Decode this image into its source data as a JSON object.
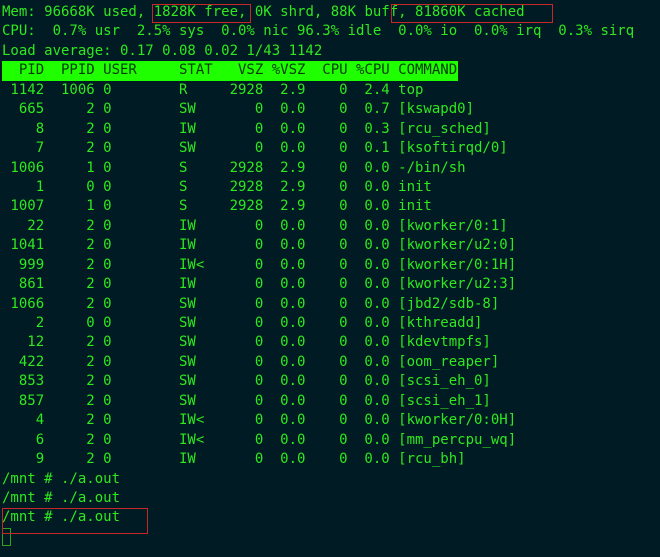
{
  "summary": {
    "mem": {
      "prefix": "Mem: 96668K used, ",
      "free": "1828K free,",
      "middle": " 0K shrd, 88K buff, ",
      "cached": "81860K cached"
    },
    "cpu": "CPU:  0.7% usr  2.5% sys  0.0% nic 96.3% idle  0.0% io  0.0% irq  0.3% sirq",
    "load": "Load average: 0.17 0.08 0.02 1/43 1142"
  },
  "table": {
    "columns": [
      "PID",
      "PPID",
      "USER",
      "STAT",
      "VSZ",
      "%VSZ",
      "CPU",
      "%CPU",
      "COMMAND"
    ],
    "rows": [
      [
        "1142",
        "1006",
        "0",
        "R",
        "2928",
        "2.9",
        "0",
        "2.4",
        "top"
      ],
      [
        "665",
        "2",
        "0",
        "SW",
        "0",
        "0.0",
        "0",
        "0.7",
        "[kswapd0]"
      ],
      [
        "8",
        "2",
        "0",
        "IW",
        "0",
        "0.0",
        "0",
        "0.3",
        "[rcu_sched]"
      ],
      [
        "7",
        "2",
        "0",
        "SW",
        "0",
        "0.0",
        "0",
        "0.1",
        "[ksoftirqd/0]"
      ],
      [
        "1006",
        "1",
        "0",
        "S",
        "2928",
        "2.9",
        "0",
        "0.0",
        "-/bin/sh"
      ],
      [
        "1",
        "0",
        "0",
        "S",
        "2928",
        "2.9",
        "0",
        "0.0",
        "init"
      ],
      [
        "1007",
        "1",
        "0",
        "S",
        "2928",
        "2.9",
        "0",
        "0.0",
        "init"
      ],
      [
        "22",
        "2",
        "0",
        "IW",
        "0",
        "0.0",
        "0",
        "0.0",
        "[kworker/0:1]"
      ],
      [
        "1041",
        "2",
        "0",
        "IW",
        "0",
        "0.0",
        "0",
        "0.0",
        "[kworker/u2:0]"
      ],
      [
        "999",
        "2",
        "0",
        "IW<",
        "0",
        "0.0",
        "0",
        "0.0",
        "[kworker/0:1H]"
      ],
      [
        "861",
        "2",
        "0",
        "IW",
        "0",
        "0.0",
        "0",
        "0.0",
        "[kworker/u2:3]"
      ],
      [
        "1066",
        "2",
        "0",
        "SW",
        "0",
        "0.0",
        "0",
        "0.0",
        "[jbd2/sdb-8]"
      ],
      [
        "2",
        "0",
        "0",
        "SW",
        "0",
        "0.0",
        "0",
        "0.0",
        "[kthreadd]"
      ],
      [
        "12",
        "2",
        "0",
        "SW",
        "0",
        "0.0",
        "0",
        "0.0",
        "[kdevtmpfs]"
      ],
      [
        "422",
        "2",
        "0",
        "SW",
        "0",
        "0.0",
        "0",
        "0.0",
        "[oom_reaper]"
      ],
      [
        "853",
        "2",
        "0",
        "SW",
        "0",
        "0.0",
        "0",
        "0.0",
        "[scsi_eh_0]"
      ],
      [
        "857",
        "2",
        "0",
        "SW",
        "0",
        "0.0",
        "0",
        "0.0",
        "[scsi_eh_1]"
      ],
      [
        "4",
        "2",
        "0",
        "IW<",
        "0",
        "0.0",
        "0",
        "0.0",
        "[kworker/0:0H]"
      ],
      [
        "6",
        "2",
        "0",
        "IW<",
        "0",
        "0.0",
        "0",
        "0.0",
        "[mm_percpu_wq]"
      ],
      [
        "9",
        "2",
        "0",
        "IW",
        "0",
        "0.0",
        "0",
        "0.0",
        "[rcu_bh]"
      ]
    ]
  },
  "shell": [
    "/mnt # ./a.out",
    "/mnt # ./a.out",
    "/mnt # ./a.out"
  ],
  "colors": {
    "text": "#2fe81f",
    "background": "#001b23",
    "header_bg": "#1fff00",
    "highlight_box": "#c62828"
  }
}
